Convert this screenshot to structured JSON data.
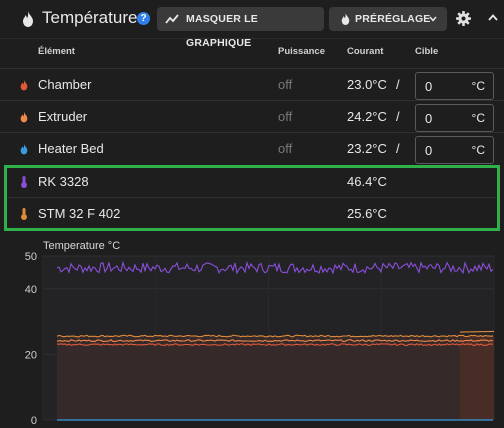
{
  "header": {
    "title": "Température",
    "help_icon": "?",
    "graph_button": "MASQUER LE GRAPHIQUE",
    "preset_button": "PRÉRÉGLAGE"
  },
  "columns": {
    "element": "Élément",
    "power": "Puissance",
    "current": "Courant",
    "target": "Cible"
  },
  "rows": [
    {
      "name": "Chamber",
      "icon_color": "#e05a3a",
      "power": "off",
      "current": "23.0°C",
      "slash": "/",
      "target": "0",
      "unit": "°C"
    },
    {
      "name": "Extruder",
      "icon_color": "#f08a4b",
      "power": "off",
      "current": "24.2°C",
      "slash": "/",
      "target": "0",
      "unit": "°C"
    },
    {
      "name": "Heater Bed",
      "icon_color": "#3a9be0",
      "power": "off",
      "current": "23.2°C",
      "slash": "/",
      "target": "0",
      "unit": "°C"
    }
  ],
  "sensors": [
    {
      "name": "RK 3328",
      "icon_color": "#8a4fd8",
      "current": "46.4°C"
    },
    {
      "name": "STM 32 F 402",
      "icon_color": "#e08a3a",
      "current": "25.6°C"
    }
  ],
  "highlight_color": "#2fb04a",
  "chart_data": {
    "type": "line",
    "ylabel": "Temperature °C",
    "yticks": [
      0,
      20,
      40,
      50
    ],
    "ylim": [
      0,
      50
    ],
    "series": [
      {
        "color": "#8a4fd8",
        "level": 46.4
      },
      {
        "color": "#e08a3a",
        "level": 25.6
      },
      {
        "color": "#f08a4b",
        "level": 24.2
      },
      {
        "color": "#e05a3a",
        "level": 23.0
      },
      {
        "color": "#3a9be0",
        "level": 0
      }
    ]
  }
}
